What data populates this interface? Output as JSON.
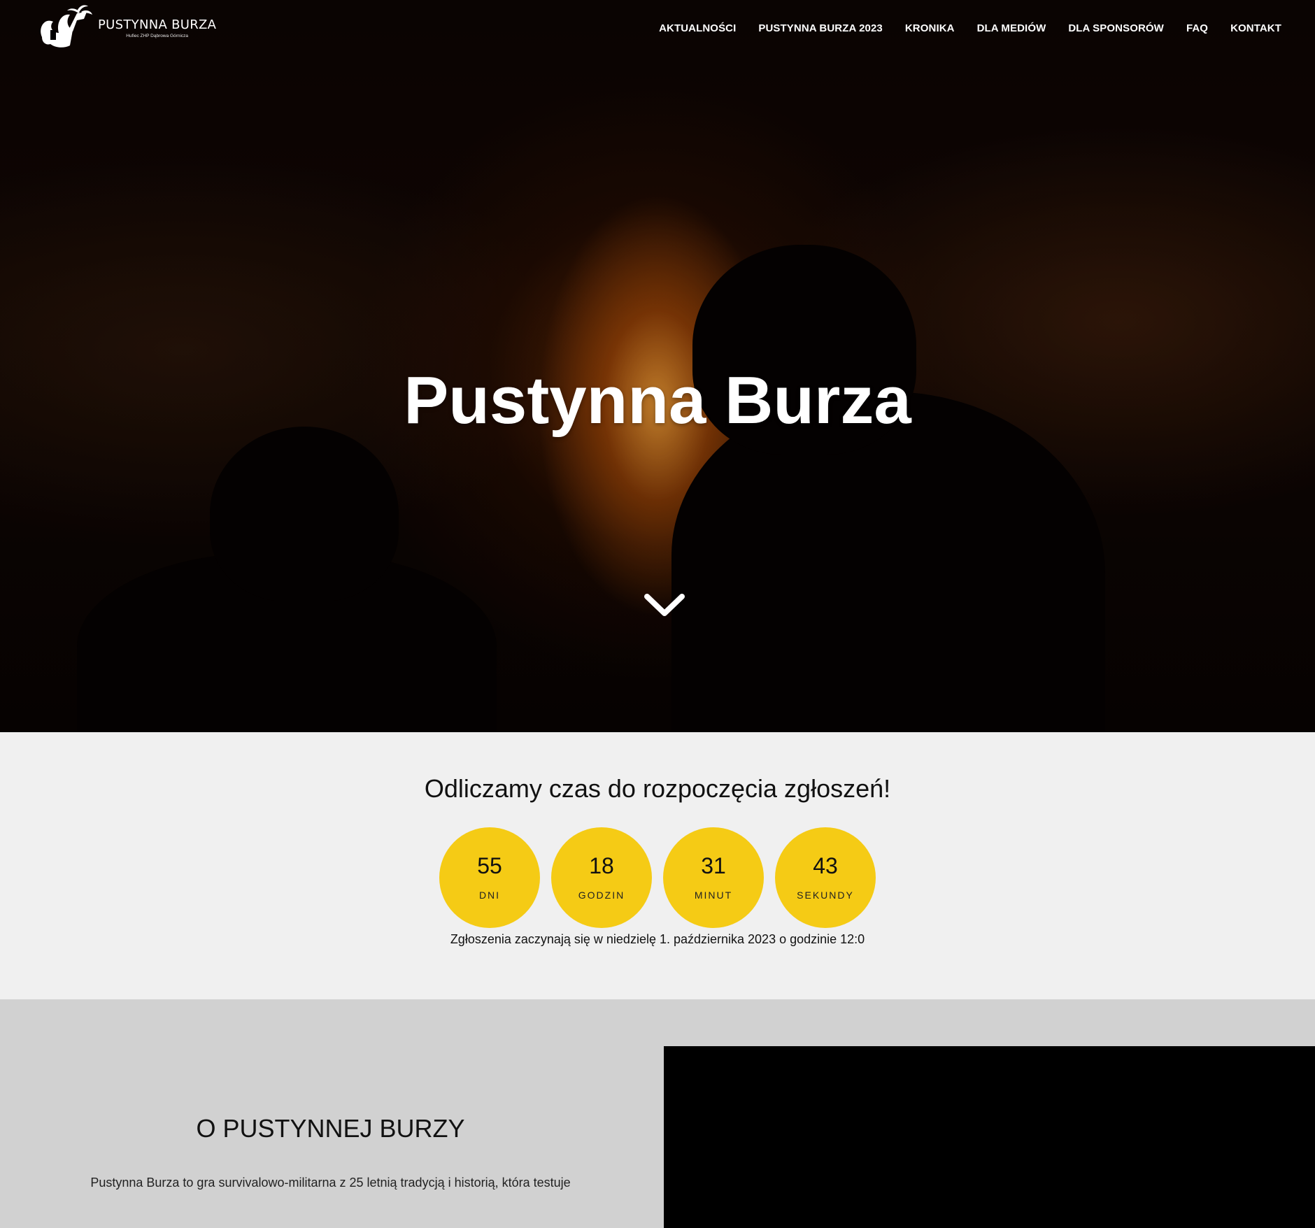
{
  "brand": {
    "title": "PUSTYNNA BURZA",
    "subtitle": "Hufiec ZHP Dąbrowa Górnicza"
  },
  "nav": {
    "items": [
      {
        "label": "AKTUALNOŚCI"
      },
      {
        "label": "PUSTYNNA BURZA 2023"
      },
      {
        "label": "KRONIKA"
      },
      {
        "label": "DLA MEDIÓW"
      },
      {
        "label": "DLA SPONSORÓW"
      },
      {
        "label": "FAQ"
      },
      {
        "label": "KONTAKT"
      }
    ]
  },
  "hero": {
    "title": "Pustynna Burza",
    "scroll_icon": "chevron-down-icon"
  },
  "countdown": {
    "heading": "Odliczamy czas do rozpoczęcia zgłoszeń!",
    "units": [
      {
        "value": "55",
        "label": "DNI"
      },
      {
        "value": "18",
        "label": "GODZIN"
      },
      {
        "value": "31",
        "label": "MINUT"
      },
      {
        "value": "43",
        "label": "SEKUNDY"
      }
    ],
    "note": "Zgłoszenia zaczynają się w niedzielę 1. października 2023 o godzinie 12:0",
    "accent": "#f5cb15"
  },
  "about": {
    "heading": "O PUSTYNNEJ BURZY",
    "text": "Pustynna Burza to gra survivalowo-militarna z 25 letnią tradycją i historią, która testuje"
  }
}
